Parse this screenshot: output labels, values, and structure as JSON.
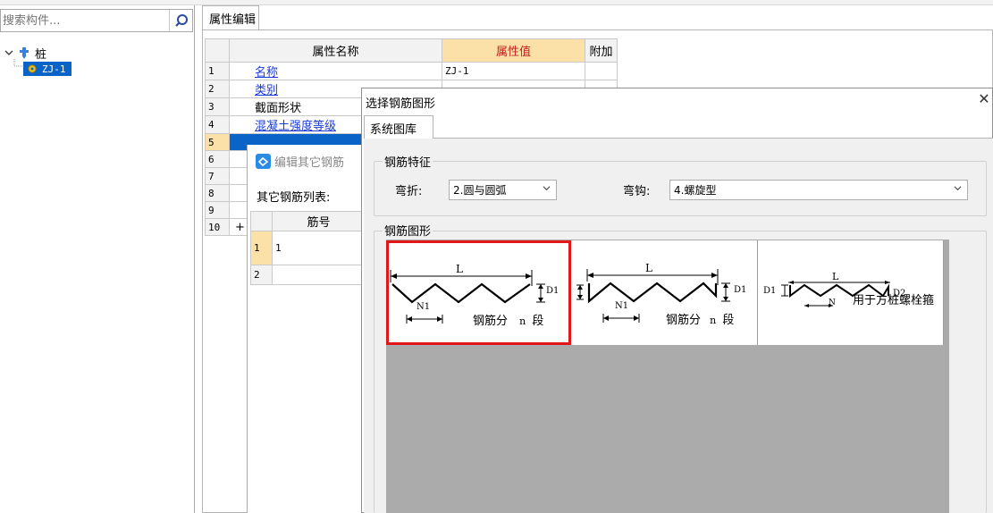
{
  "left_panel": {
    "search_placeholder": "搜索构件...",
    "tree_root": "桩",
    "tree_child": "ZJ-1"
  },
  "property_panel": {
    "tab_label": "属性编辑",
    "headers": [
      "属性名称",
      "属性值",
      "附加"
    ],
    "rows": [
      {
        "num": "1",
        "name": "名称",
        "value": "ZJ-1"
      },
      {
        "num": "2",
        "name": "类别",
        "value": ""
      },
      {
        "num": "3",
        "name": "截面形状",
        "value": ""
      },
      {
        "num": "4",
        "name": "混凝土强度等级",
        "value": ""
      },
      {
        "num": "5",
        "name": "",
        "value": ""
      },
      {
        "num": "6",
        "name": "",
        "value": ""
      },
      {
        "num": "7",
        "name": "",
        "value": ""
      },
      {
        "num": "8",
        "name": "",
        "value": ""
      },
      {
        "num": "9",
        "name": "",
        "value": ""
      },
      {
        "num": "10",
        "name": "+",
        "value": ""
      }
    ]
  },
  "sub_dialog": {
    "title": "编辑其它钢筋",
    "list_label": "其它钢筋列表:",
    "header": "筋号",
    "rows": [
      {
        "num": "1",
        "value": "1"
      },
      {
        "num": "2",
        "value": ""
      }
    ]
  },
  "dialog": {
    "title": "选择钢筋图形",
    "close_glyph": "✕",
    "tab_label": "系统图库",
    "feature_legend": "钢筋特征",
    "bend_label": "弯折:",
    "bend_value": "2.圆与圆弧",
    "hook_label": "弯钩:",
    "hook_value": "4.螺旋型",
    "shape_legend": "钢筋图形",
    "shapes": [
      {
        "L": "L",
        "N": "N1",
        "D1": "D1",
        "n": "n",
        "note_a": "钢筋分",
        "note_b": "段"
      },
      {
        "L": "L",
        "N": "N1",
        "D1": "D1",
        "n": "n",
        "note_a": "钢筋分",
        "note_b": "段"
      },
      {
        "L": "L",
        "N": "N",
        "D1": "D1",
        "D2": "D2",
        "note": "用于方桩螺栓箍"
      }
    ],
    "selected_shape": 0
  },
  "colors": {
    "selection_blue": "#0a64c8",
    "highlight_header": "#fbe1a7",
    "selected_border": "#e01818",
    "link_blue": "#1c3bd6"
  }
}
